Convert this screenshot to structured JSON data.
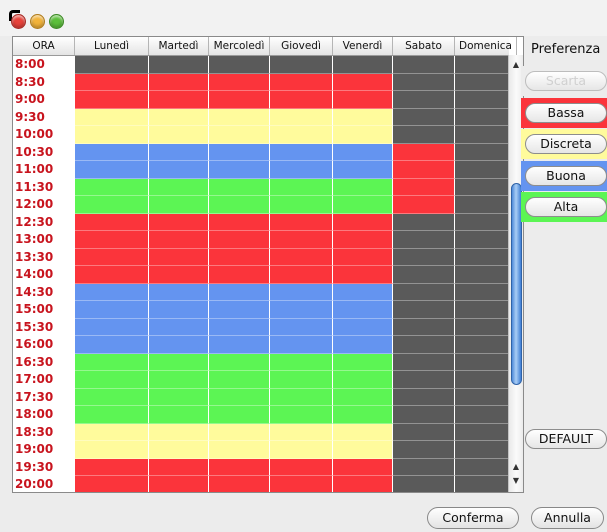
{
  "window": {
    "traffic_lights": [
      "close",
      "minimize",
      "zoom"
    ]
  },
  "columns": [
    "ORA",
    "Lunedì",
    "Martedì",
    "Mercoledì",
    "Giovedì",
    "Venerdì",
    "Sabato",
    "Domenica"
  ],
  "colors": {
    "G": "#5a5a5a",
    "R": "#fb343b",
    "Y": "#fffb9c",
    "B": "#6494f0",
    "N": "#5cf554"
  },
  "rows": [
    {
      "time": "8:00",
      "cells": "GGGGGGG"
    },
    {
      "time": "8:30",
      "cells": "RRRRRGG"
    },
    {
      "time": "9:00",
      "cells": "RRRRRGG"
    },
    {
      "time": "9:30",
      "cells": "YYYYYGG"
    },
    {
      "time": "10:00",
      "cells": "YYYYYGG"
    },
    {
      "time": "10:30",
      "cells": "BBBBBRG"
    },
    {
      "time": "11:00",
      "cells": "BBBBBRG"
    },
    {
      "time": "11:30",
      "cells": "NNNNNRG"
    },
    {
      "time": "12:00",
      "cells": "NNNNNRG"
    },
    {
      "time": "12:30",
      "cells": "RRRRRGG"
    },
    {
      "time": "13:00",
      "cells": "RRRRRGG"
    },
    {
      "time": "13:30",
      "cells": "RRRRRGG"
    },
    {
      "time": "14:00",
      "cells": "RRRRRGG"
    },
    {
      "time": "14:30",
      "cells": "BBBBBGG"
    },
    {
      "time": "15:00",
      "cells": "BBBBBGG"
    },
    {
      "time": "15:30",
      "cells": "BBBBBGG"
    },
    {
      "time": "16:00",
      "cells": "BBBBBGG"
    },
    {
      "time": "16:30",
      "cells": "NNNNNGG"
    },
    {
      "time": "17:00",
      "cells": "NNNNNGG"
    },
    {
      "time": "17:30",
      "cells": "NNNNNGG"
    },
    {
      "time": "18:00",
      "cells": "NNNNNGG"
    },
    {
      "time": "18:30",
      "cells": "YYYYYGG"
    },
    {
      "time": "19:00",
      "cells": "YYYYYGG"
    },
    {
      "time": "19:30",
      "cells": "RRRRRGG"
    },
    {
      "time": "20:00",
      "cells": "RRRRRGG"
    }
  ],
  "preferenza": {
    "title": "Preferenza",
    "buttons": [
      {
        "label": "Scarta",
        "color": "#ececec",
        "disabled": true
      },
      {
        "label": "Bassa",
        "color": "#fb343b",
        "disabled": false
      },
      {
        "label": "Discreta",
        "color": "#fffb9c",
        "disabled": false
      },
      {
        "label": "Buona",
        "color": "#6494f0",
        "disabled": false
      },
      {
        "label": "Alta",
        "color": "#5cf554",
        "disabled": false
      }
    ],
    "default_label": "DEFAULT"
  },
  "footer": {
    "confirm_label": "Conferma",
    "cancel_label": "Annulla"
  }
}
